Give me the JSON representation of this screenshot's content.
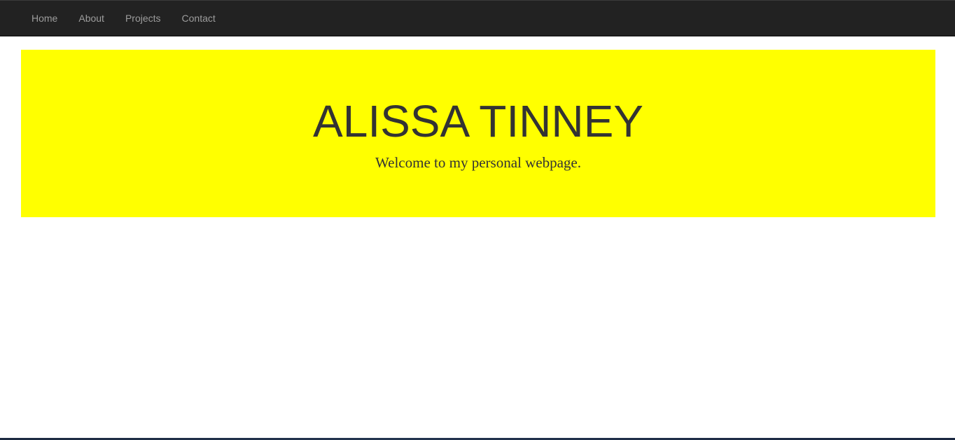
{
  "nav": {
    "items": [
      {
        "label": "Home"
      },
      {
        "label": "About"
      },
      {
        "label": "Projects"
      },
      {
        "label": "Contact"
      }
    ]
  },
  "hero": {
    "title": "ALISSA TINNEY",
    "subtitle": "Welcome to my personal webpage."
  },
  "colors": {
    "navbar": "#222222",
    "nav_link": "#9d9d9d",
    "hero_background": "#ffff00",
    "hero_text": "#333333",
    "page_background": "#ffffff"
  }
}
